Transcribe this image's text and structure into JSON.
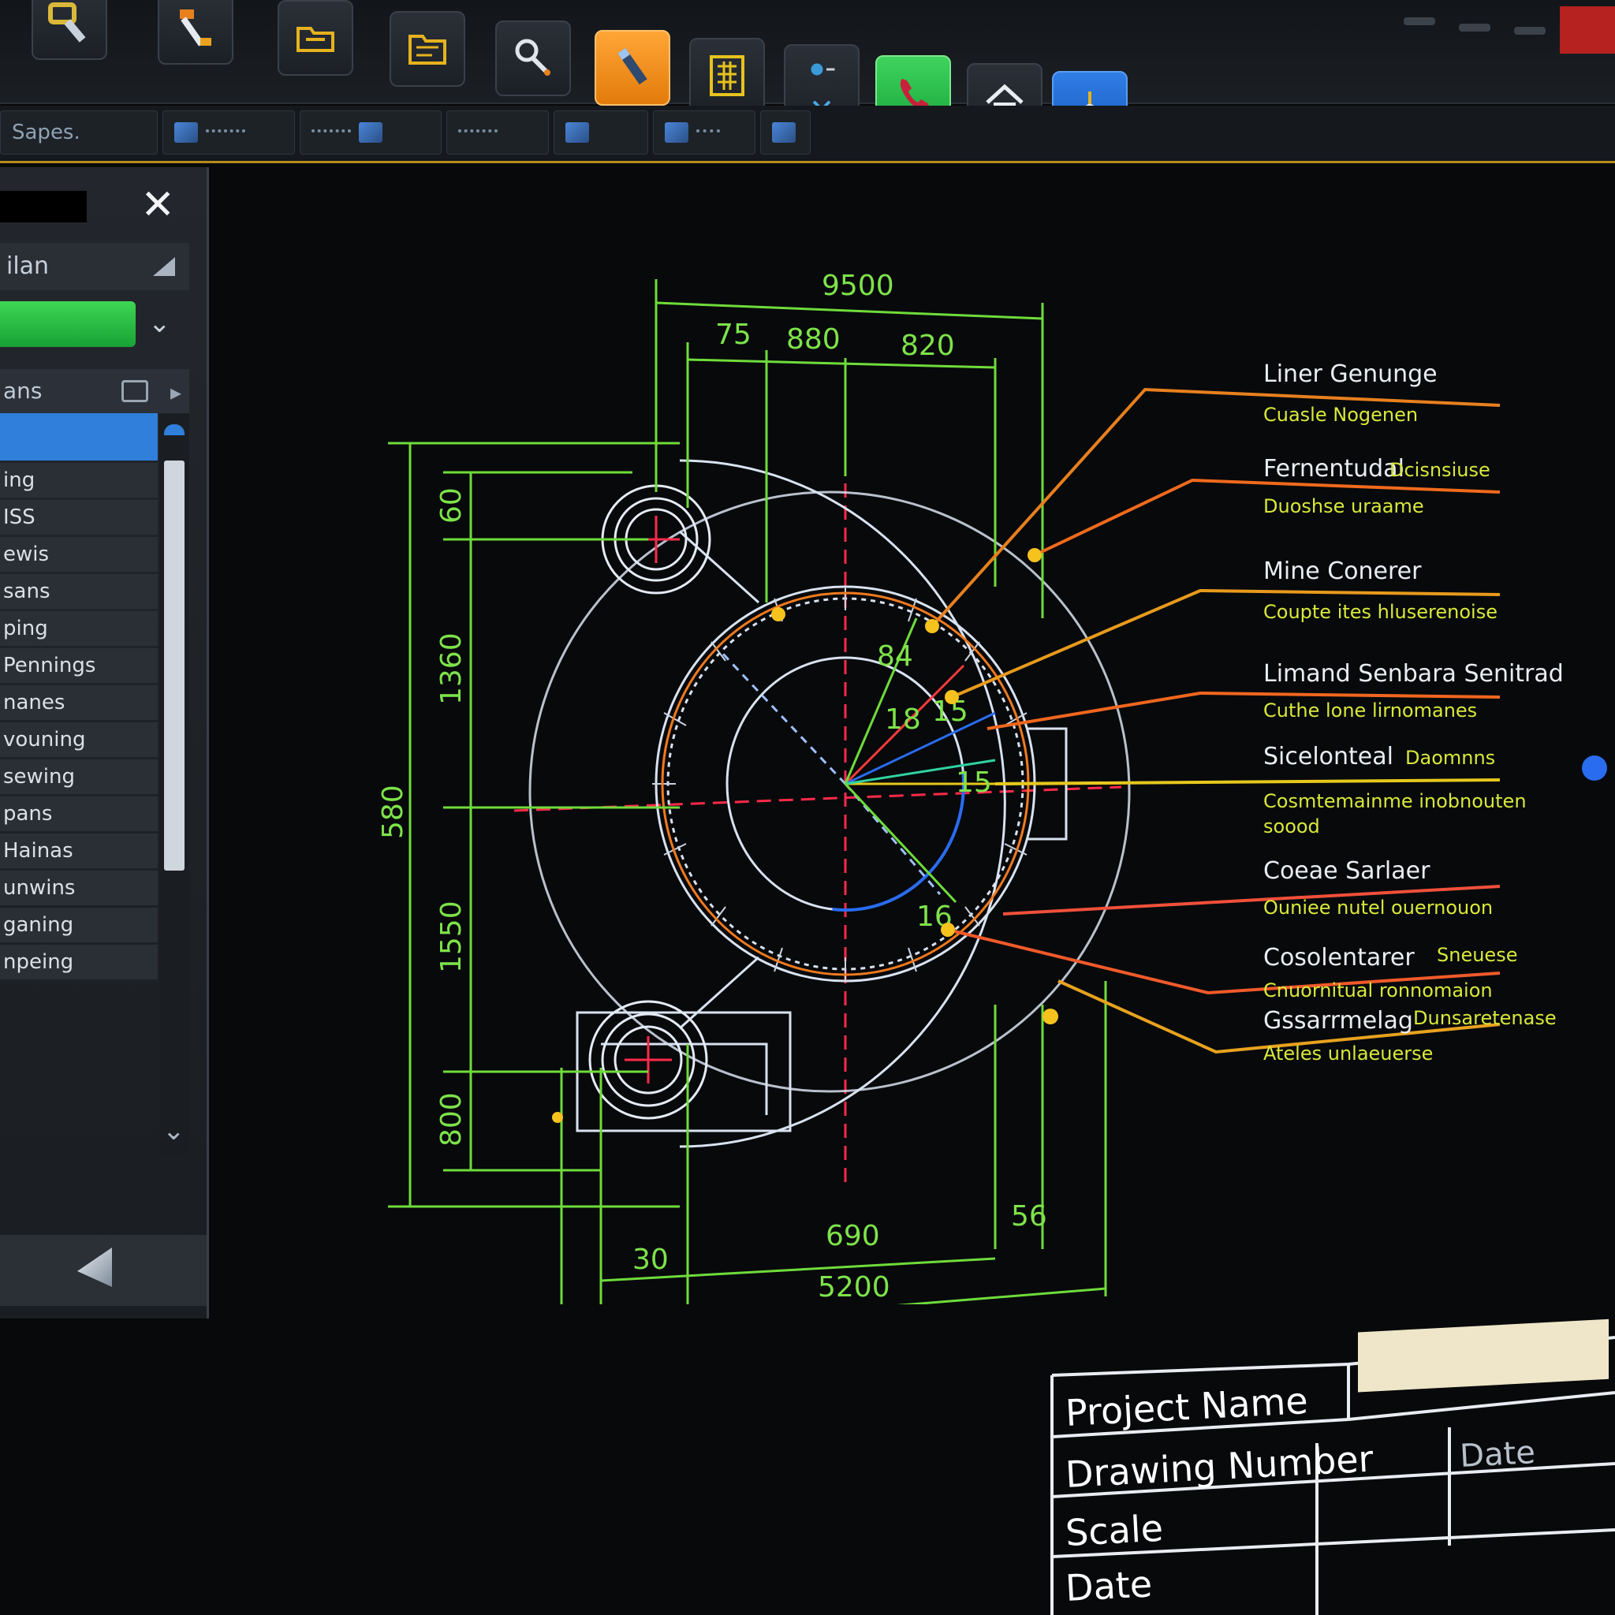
{
  "toolbar": {
    "buttons": [
      {
        "icon": "wrench-clamp-icon"
      },
      {
        "icon": "hammer-icon"
      },
      {
        "icon": "folder-link-icon"
      },
      {
        "icon": "folder-open-icon"
      },
      {
        "icon": "magnifier-icon"
      },
      {
        "icon": "pencil-icon",
        "active_color": "#f28c14"
      },
      {
        "icon": "calculator-grid-icon"
      },
      {
        "icon": "layer-dropdown-icon"
      },
      {
        "icon": "phone-icon",
        "active_color": "#23b842"
      },
      {
        "icon": "home-icon"
      },
      {
        "icon": "crosshair-icon",
        "active_color": "#1f6ad0"
      }
    ]
  },
  "ribbon": {
    "tabs": [
      {
        "label": "Sapes."
      },
      {
        "label": ""
      },
      {
        "label": ""
      },
      {
        "label": ""
      },
      {
        "label": ""
      },
      {
        "label": ""
      }
    ]
  },
  "side_panel": {
    "close_glyph": "✕",
    "row_label": "ilan",
    "list_header": "ans",
    "list_items": [
      "",
      "ing",
      "ISS",
      "ewis",
      "sans",
      "ping",
      "Pennings",
      "nanes",
      "vouning",
      "sewing",
      "pans",
      "Hainas",
      "unwins",
      "ganing",
      "npeing"
    ]
  },
  "drawing": {
    "dimensions": {
      "top_overall": "9500",
      "top_segment_1": "75",
      "top_segment_2": "880",
      "top_segment_3": "820",
      "left_overall": "580",
      "left_segment_1": "60",
      "left_segment_2": "1360",
      "left_segment_3": "1550",
      "left_segment_4": "800",
      "bottom_segment_1": "30",
      "bottom_segment_2": "690",
      "bottom_segment_3": "56",
      "bottom_overall": "5200",
      "angle_1": "84",
      "angle_2": "18",
      "angle_3": "15",
      "angle_4": "15",
      "angle_5": "16"
    },
    "callouts": [
      {
        "title": "Liner Genunge",
        "sub": "Cuasle Nogenen",
        "color": "#e8801e"
      },
      {
        "title": "Fernentudal",
        "title_hl": "Dcisnsiuse",
        "sub": "Duoshse uraame",
        "color": "#f06a1c"
      },
      {
        "title": "Mine Conerer",
        "sub": "Coupte ites hluserenoise",
        "color": "#e89a1c"
      },
      {
        "title": "Limand Senbara Senitrad",
        "sub": "Cuthe lone lirnomanes",
        "color": "#f0661e"
      },
      {
        "title": "Sicelonteal",
        "title_hl": "Daomnns",
        "sub": "Cosmtemainme inobnouten",
        "sub2": "soood",
        "color": "#e6c81c"
      },
      {
        "title": "Coeae Sarlaer",
        "sub": "Ouniee nutel ouernouon",
        "color": "#f0503a"
      },
      {
        "title": "Cosolentarer",
        "title_hl": "Sneuese",
        "sub": "Cnuornitual ronnomaion",
        "color": "#f05a2a"
      },
      {
        "title": "Gssarrmelag",
        "title_hl": "Dunsaretenase",
        "sub": "Ateles unlaeuerse",
        "color": "#e8a21e"
      }
    ]
  },
  "title_block": {
    "project_name_label": "Project Name",
    "drawing_number_label": "Drawing Number",
    "scale_label": "Scale",
    "date_label": "Date",
    "date_header": "Date"
  },
  "colors": {
    "background": "#07090b",
    "dimension_green": "#6fdc3a",
    "geometry_white": "#d8e2f0",
    "centerline_red": "#ff2a4a",
    "accent_orange": "#f28c14"
  }
}
